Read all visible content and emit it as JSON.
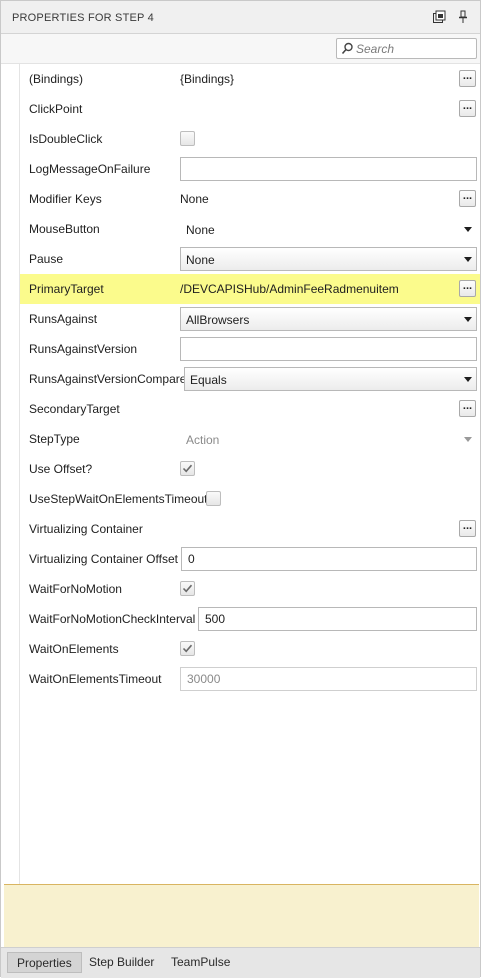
{
  "panel": {
    "title": "PROPERTIES FOR STEP 4",
    "restore_icon": "restore-window-icon",
    "pin_icon": "pin-icon"
  },
  "search": {
    "placeholder": "Search",
    "icon": "search-icon"
  },
  "properties": {
    "bindings": {
      "label": "(Bindings)",
      "value": "{Bindings}"
    },
    "clickpoint": {
      "label": "ClickPoint"
    },
    "isdoubleclick": {
      "label": "IsDoubleClick",
      "checked": false
    },
    "logmessageonfailure": {
      "label": "LogMessageOnFailure",
      "value": ""
    },
    "modifierkeys": {
      "label": "Modifier Keys",
      "value": "None"
    },
    "mousebutton": {
      "label": "MouseButton",
      "value": "None"
    },
    "pause": {
      "label": "Pause",
      "value": "None"
    },
    "primarytarget": {
      "label": "PrimaryTarget",
      "value": "/DEVCAPISHub/AdminFeeRadmenuitem",
      "highlighted": true
    },
    "runsagainst": {
      "label": "RunsAgainst",
      "value": "AllBrowsers"
    },
    "runsagainstversion": {
      "label": "RunsAgainstVersion",
      "value": ""
    },
    "runsagainstversioncompare": {
      "label": "RunsAgainstVersionCompare",
      "value": "Equals"
    },
    "secondarytarget": {
      "label": "SecondaryTarget"
    },
    "steptype": {
      "label": "StepType",
      "value": "Action"
    },
    "useoffset": {
      "label": "Use Offset?",
      "checked": true
    },
    "usestepwait": {
      "label": "UseStepWaitOnElementsTimeout",
      "checked": false
    },
    "virtualizingcontainer": {
      "label": "Virtualizing Container"
    },
    "virtualizingcontaineroffset": {
      "label": "Virtualizing Container Offset",
      "value": "0"
    },
    "waitfornomotion": {
      "label": "WaitForNoMotion",
      "checked": true
    },
    "waitfornomotioncheckinterval": {
      "label": "WaitForNoMotionCheckInterval",
      "value": "500"
    },
    "waitonelements": {
      "label": "WaitOnElements",
      "checked": true
    },
    "waitonelementstimeout": {
      "label": "WaitOnElementsTimeout",
      "value": "30000"
    }
  },
  "ellipsis_label": "...",
  "tabs": [
    {
      "label": "Properties",
      "active": true
    },
    {
      "label": "Step Builder",
      "active": false
    },
    {
      "label": "TeamPulse",
      "active": false
    }
  ],
  "colors": {
    "highlight": "#fbfb8c",
    "description_bg": "#f8f1cf"
  }
}
